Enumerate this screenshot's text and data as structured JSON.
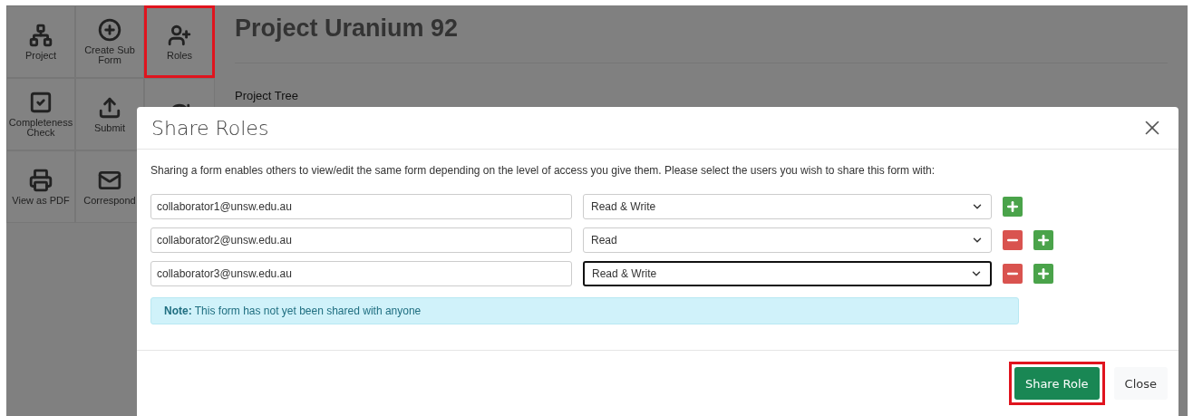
{
  "sidebar": {
    "tiles": [
      {
        "kind": "project",
        "label": "Project",
        "highlighted": false
      },
      {
        "kind": "add",
        "label": "Create Sub Form",
        "highlighted": false
      },
      {
        "kind": "roles",
        "label": "Roles",
        "highlighted": true
      },
      {
        "kind": "check",
        "label": "Completeness Check",
        "highlighted": false
      },
      {
        "kind": "submit",
        "label": "Submit",
        "highlighted": false
      },
      {
        "kind": "refresh",
        "highlighted": false
      },
      {
        "kind": "print",
        "label": "View as PDF",
        "highlighted": false
      },
      {
        "kind": "mail",
        "label": "Correspond",
        "highlighted": false
      }
    ]
  },
  "page": {
    "title": "Project Uranium 92",
    "section": "Project Tree"
  },
  "modal": {
    "title": "Share Roles",
    "intro": "Sharing a form enables others to view/edit the same form depending on the level of access you give them. Please select the users you wish to share this form with:",
    "rows": [
      {
        "email": "collaborator1@unsw.edu.au",
        "access": "Read & Write",
        "focused": false,
        "removable": false
      },
      {
        "email": "collaborator2@unsw.edu.au",
        "access": "Read",
        "focused": false,
        "removable": true
      },
      {
        "email": "collaborator3@unsw.edu.au",
        "access": "Read & Write",
        "focused": true,
        "removable": true
      }
    ],
    "note": "**Note:** This form has not yet been shared with anyone",
    "buttons": [
      {
        "kind": "primary",
        "label": "Share Role",
        "highlighted": true
      },
      {
        "kind": "secondary",
        "label": "Close",
        "highlighted": false
      }
    ]
  }
}
